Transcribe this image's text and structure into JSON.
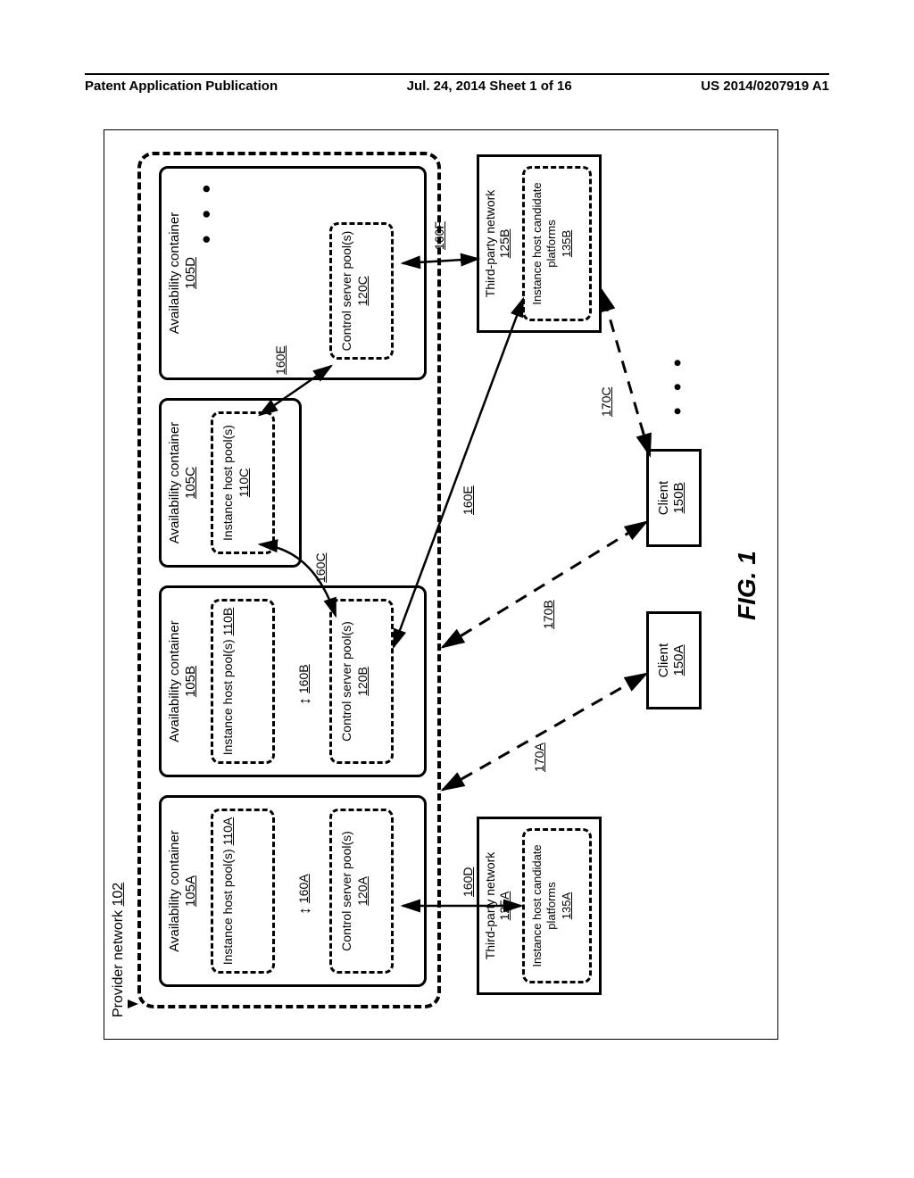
{
  "header": {
    "left": "Patent Application Publication",
    "center": "Jul. 24, 2014  Sheet 1 of 16",
    "right": "US 2014/0207919 A1"
  },
  "provider": {
    "label_prefix": "Provider network ",
    "label_ref": "102"
  },
  "containers": [
    {
      "title": "Availability container",
      "ref": "105A",
      "instance_host": {
        "title": "Instance host pool(s) ",
        "ref": "110A"
      },
      "control_server": {
        "title": "Control server pool(s) ",
        "ref": "120A"
      },
      "link_ref": "160A"
    },
    {
      "title": "Availability container",
      "ref": "105B",
      "instance_host": {
        "title": "Instance host pool(s) ",
        "ref": "110B"
      },
      "control_server": {
        "title": "Control server pool(s) ",
        "ref": "120B"
      },
      "link_ref": "160B"
    },
    {
      "title": "Availability container",
      "ref": "105C",
      "instance_host": {
        "title": "Instance host pool(s) ",
        "ref": "110C"
      },
      "control_server": null,
      "link_ref": null
    },
    {
      "title": "Availability container",
      "ref": "105D",
      "instance_host": null,
      "control_server": {
        "title": "Control server pool(s) ",
        "ref": "120C"
      },
      "link_ref": null
    }
  ],
  "ellipsis": "• • •",
  "third_party": [
    {
      "title": "Third-party network",
      "ref": "125A",
      "inner": {
        "title": "Instance host candidate platforms",
        "ref": "135A"
      }
    },
    {
      "title": "Third-party network",
      "ref": "125B",
      "inner": {
        "title": "Instance host candidate platforms",
        "ref": "135B"
      }
    }
  ],
  "clients": [
    {
      "title": "Client",
      "ref": "150A"
    },
    {
      "title": "Client",
      "ref": "150B"
    }
  ],
  "client_ellipsis": "• • •",
  "edge_labels": {
    "e160C": "160C",
    "e160D": "160D",
    "e160E_upper": "160E",
    "e160E_lower": "160E",
    "e160F": "160F",
    "e170A": "170A",
    "e170B": "170B",
    "e170C": "170C"
  },
  "figure_label": "FIG. 1",
  "chart_data": {
    "type": "diagram",
    "description": "System architecture: a Provider network 102 contains four Availability containers (105A–105D) with instance host pools (110A–C) and control server pools (120A–C). Control servers connect (160x) to instance hosts inside and across containers and to third-party networks (125A,125B) hosting instance host candidate platforms (135A,135B). Clients (150A,150B) reach the provider network via dashed links (170A–170C).",
    "nodes": [
      {
        "id": "102",
        "label": "Provider network"
      },
      {
        "id": "105A",
        "label": "Availability container",
        "parent": "102"
      },
      {
        "id": "105B",
        "label": "Availability container",
        "parent": "102"
      },
      {
        "id": "105C",
        "label": "Availability container",
        "parent": "102"
      },
      {
        "id": "105D",
        "label": "Availability container",
        "parent": "102"
      },
      {
        "id": "110A",
        "label": "Instance host pool(s)",
        "parent": "105A"
      },
      {
        "id": "110B",
        "label": "Instance host pool(s)",
        "parent": "105B"
      },
      {
        "id": "110C",
        "label": "Instance host pool(s)",
        "parent": "105C"
      },
      {
        "id": "120A",
        "label": "Control server pool(s)",
        "parent": "105A"
      },
      {
        "id": "120B",
        "label": "Control server pool(s)",
        "parent": "105B"
      },
      {
        "id": "120C",
        "label": "Control server pool(s)",
        "parent": "105D"
      },
      {
        "id": "125A",
        "label": "Third-party network"
      },
      {
        "id": "125B",
        "label": "Third-party network"
      },
      {
        "id": "135A",
        "label": "Instance host candidate platforms",
        "parent": "125A"
      },
      {
        "id": "135B",
        "label": "Instance host candidate platforms",
        "parent": "125B"
      },
      {
        "id": "150A",
        "label": "Client"
      },
      {
        "id": "150B",
        "label": "Client"
      }
    ],
    "edges": [
      {
        "id": "160A",
        "from": "120A",
        "to": "110A",
        "style": "solid",
        "bidir": true
      },
      {
        "id": "160B",
        "from": "120B",
        "to": "110B",
        "style": "solid",
        "bidir": true
      },
      {
        "id": "160C",
        "from": "120B",
        "to": "110C",
        "style": "solid",
        "bidir": true
      },
      {
        "id": "160D",
        "from": "120A",
        "to": "135A",
        "style": "solid",
        "bidir": true
      },
      {
        "id": "160E",
        "from": "120C",
        "to": "110C",
        "style": "solid",
        "bidir": true
      },
      {
        "id": "160E",
        "from": "120B",
        "to": "135B",
        "style": "solid",
        "bidir": true
      },
      {
        "id": "160F",
        "from": "120C",
        "to": "135B",
        "style": "solid",
        "bidir": true
      },
      {
        "id": "170A",
        "from": "150A",
        "to": "102",
        "style": "dashed",
        "bidir": true
      },
      {
        "id": "170B",
        "from": "150B",
        "to": "102",
        "style": "dashed",
        "bidir": true
      },
      {
        "id": "170C",
        "from": "150B",
        "to": "125B",
        "style": "dashed",
        "bidir": true
      }
    ]
  }
}
